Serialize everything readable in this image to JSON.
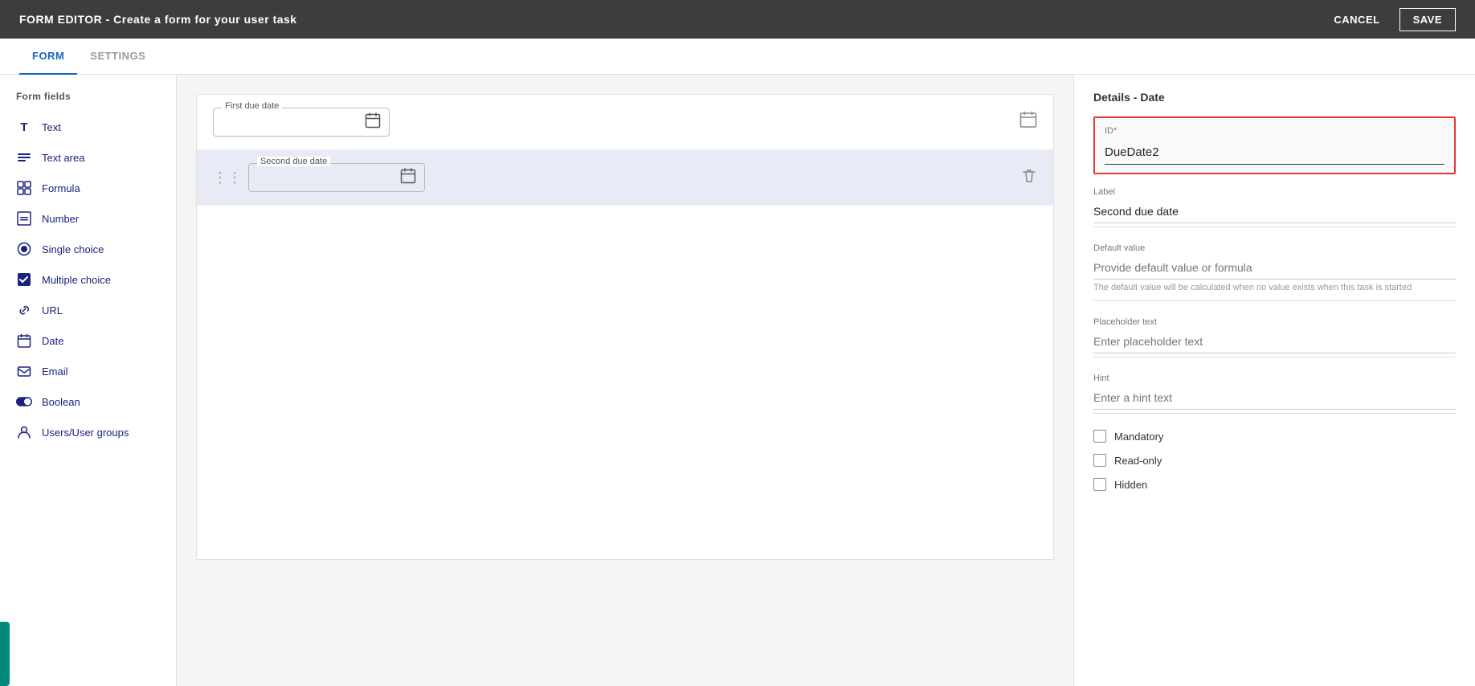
{
  "header": {
    "title": "FORM EDITOR - Create a form for your user task",
    "cancel_label": "CANCEL",
    "save_label": "SAVE"
  },
  "tabs": [
    {
      "id": "form",
      "label": "FORM",
      "active": true
    },
    {
      "id": "settings",
      "label": "SETTINGS",
      "active": false
    }
  ],
  "sidebar": {
    "section_title": "Form fields",
    "items": [
      {
        "id": "text",
        "label": "Text",
        "icon": "T"
      },
      {
        "id": "textarea",
        "label": "Text area",
        "icon": "≡"
      },
      {
        "id": "formula",
        "label": "Formula",
        "icon": "⊞"
      },
      {
        "id": "number",
        "label": "Number",
        "icon": "⊟"
      },
      {
        "id": "single-choice",
        "label": "Single choice",
        "icon": "◎"
      },
      {
        "id": "multiple-choice",
        "label": "Multiple choice",
        "icon": "☑"
      },
      {
        "id": "url",
        "label": "URL",
        "icon": "⊕"
      },
      {
        "id": "date",
        "label": "Date",
        "icon": "📅"
      },
      {
        "id": "email",
        "label": "Email",
        "icon": "✉"
      },
      {
        "id": "boolean",
        "label": "Boolean",
        "icon": "⊙"
      },
      {
        "id": "users",
        "label": "Users/User groups",
        "icon": "👤"
      }
    ]
  },
  "canvas": {
    "rows": [
      {
        "id": "first-due-date-row",
        "label": "First due date",
        "selected": false
      },
      {
        "id": "second-due-date-row",
        "label": "Second due date",
        "selected": true
      }
    ]
  },
  "details": {
    "title": "Details - Date",
    "id_label": "ID*",
    "id_value": "DueDate2",
    "label_field": "Label",
    "label_value": "Second due date",
    "default_value_label": "Default value",
    "default_value_placeholder": "Provide default value or formula",
    "default_hint": "The default value will be calculated when no value exists when this task is started",
    "placeholder_text_label": "Placeholder text",
    "placeholder_text_placeholder": "Enter placeholder text",
    "hint_label": "Hint",
    "hint_placeholder": "Enter a hint text",
    "checkboxes": [
      {
        "id": "mandatory",
        "label": "Mandatory",
        "checked": false
      },
      {
        "id": "read-only",
        "label": "Read-only",
        "checked": false
      },
      {
        "id": "hidden",
        "label": "Hidden",
        "checked": false
      }
    ]
  }
}
